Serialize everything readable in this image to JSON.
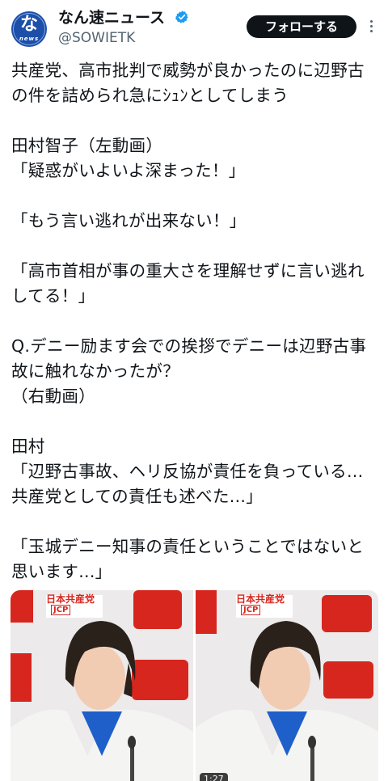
{
  "account": {
    "display_name": "なん速ニュース",
    "handle": "@SOWIETK",
    "avatar_text": "な",
    "avatar_subtext": "news",
    "verified": true
  },
  "actions": {
    "follow_label": "フォローする",
    "more_icon": "more-vertical-icon"
  },
  "post": {
    "text": "共産党、高市批判で威勢が良かったのに辺野古の件を詰められ急にｼｭﾝとしてしまう\n\n田村智子（左動画）\n「疑惑がいよいよ深まった！」\n\n「もう言い逃れが出来ない！」\n\n「高市首相が事の重大さを理解せずに言い逃れしてる！」\n\nQ.デニー励ます会での挨拶でデニーは辺野古事故に触れなかったが？\n（右動画）\n\n田村\n「辺野古事故、ヘリ反協が責任を負っている...共産党としての責任も述べた...」\n\n「玉城デニー知事の責任ということではないと思います...」"
  },
  "media": [
    {
      "kind": "video-thumbnail",
      "sign_text": "日本共産党",
      "logo_text": "JCP"
    },
    {
      "kind": "video-thumbnail",
      "sign_text": "日本共産党",
      "logo_text": "JCP",
      "duration": "1:27"
    }
  ],
  "colors": {
    "accent_verified": "#1d9bf0",
    "follow_bg": "#0f1419",
    "text_primary": "#0f1419",
    "text_secondary": "#536471",
    "party_red": "#d7261e"
  }
}
